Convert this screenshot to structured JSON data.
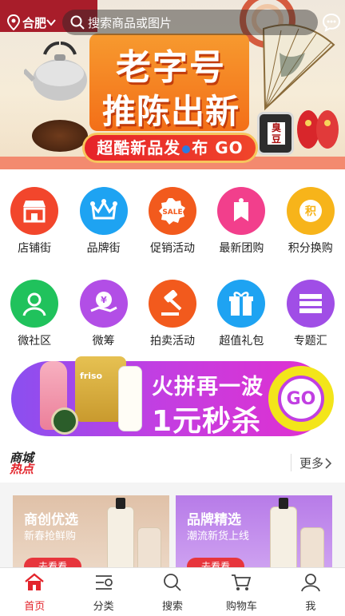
{
  "header": {
    "city": "合肥",
    "search_placeholder": "搜索商品或图片"
  },
  "hero": {
    "title_line1": "老字号",
    "title_line2": "推陈出新",
    "cta_left": "超酷新品发",
    "cta_right": "布 GO",
    "jar_label": "臭豆"
  },
  "icons": [
    {
      "label": "店铺街",
      "icon": "store-icon",
      "color": "#f2462c"
    },
    {
      "label": "品牌街",
      "icon": "crown-icon",
      "color": "#1ea3f2"
    },
    {
      "label": "促销活动",
      "icon": "sale-icon",
      "color": "#f25a1d"
    },
    {
      "label": "最新团购",
      "icon": "tag-icon",
      "color": "#f23f8c"
    },
    {
      "label": "积分换购",
      "icon": "points-icon",
      "color": "#f7b41a"
    },
    {
      "label": "微社区",
      "icon": "community-icon",
      "color": "#20c25c"
    },
    {
      "label": "微筹",
      "icon": "crowdfund-icon",
      "color": "#b24ee6"
    },
    {
      "label": "拍卖活动",
      "icon": "auction-icon",
      "color": "#f25a1d"
    },
    {
      "label": "超值礼包",
      "icon": "gift-icon",
      "color": "#1ea3f2"
    },
    {
      "label": "专题汇",
      "icon": "topic-icon",
      "color": "#a04ee6"
    }
  ],
  "promo": {
    "line1": "火拼再一波",
    "line2": "1元秒杀",
    "go": "GO",
    "can_label": "friso"
  },
  "section": {
    "logo_top": "商城",
    "logo_bottom": "热点",
    "more": "更多"
  },
  "cards": [
    {
      "title": "商创优选",
      "subtitle": "新春抢鲜购",
      "button": "去看看"
    },
    {
      "title": "品牌精选",
      "subtitle": "潮流新货上线",
      "button": "去看看"
    }
  ],
  "tabs": [
    {
      "label": "首页",
      "icon": "home-icon",
      "active": true
    },
    {
      "label": "分类",
      "icon": "category-icon"
    },
    {
      "label": "搜索",
      "icon": "search-icon"
    },
    {
      "label": "购物车",
      "icon": "cart-icon"
    },
    {
      "label": "我",
      "icon": "user-icon"
    }
  ],
  "colors": {
    "accent": "#e3242b",
    "promo": "#c13fe2"
  }
}
